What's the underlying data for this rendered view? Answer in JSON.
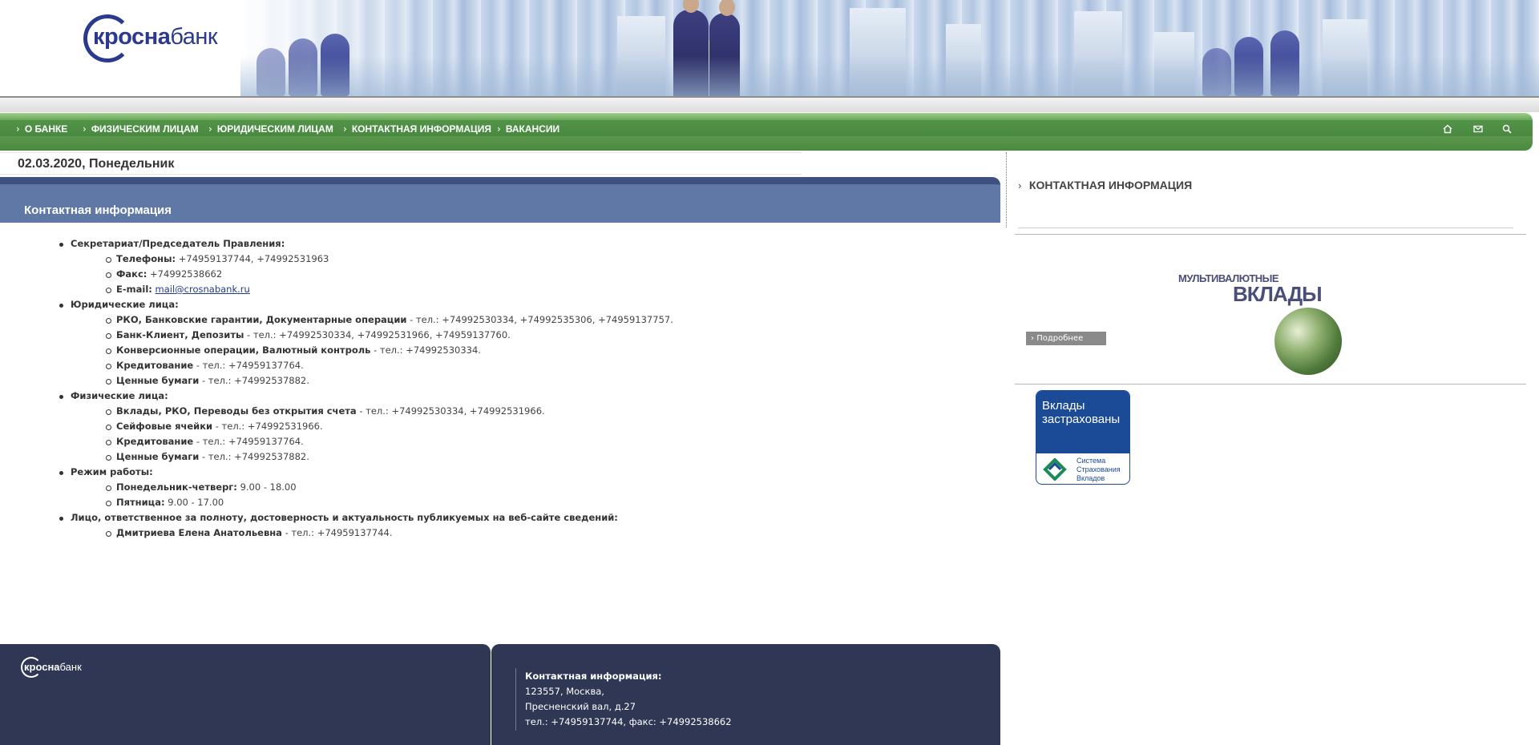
{
  "brand": {
    "name_bold": "кросна",
    "name_rest": "банк"
  },
  "nav": {
    "items": [
      {
        "label": "О БАНКЕ"
      },
      {
        "label": "ФИЗИЧЕСКИМ ЛИЦАМ"
      },
      {
        "label": "ЮРИДИЧЕСКИМ ЛИЦАМ"
      },
      {
        "label": "КОНТАКТНАЯ ИНФОРМАЦИЯ"
      },
      {
        "label": "ВАКАНСИИ"
      }
    ],
    "icons": [
      "home-icon",
      "mail-icon",
      "search-icon"
    ]
  },
  "date": "02.03.2020, Понедельник",
  "page_title": "Контактная информация",
  "content": {
    "secretariat": {
      "heading": "Секретариат/Председатель Правления:",
      "phones_label": "Телефоны:",
      "phones_value": " +74959137744, +74992531963",
      "fax_label": "Факс:",
      "fax_value": " +74992538662",
      "email_label": "E-mail:",
      "email_value": "mail@crosnabank.ru"
    },
    "legal": {
      "heading": "Юридические лица:",
      "items": [
        {
          "label": "РКО, Банковские гарантии, Документарные операции",
          "value": " - тел.: +74992530334, +74992535306, +74959137757."
        },
        {
          "label": "Банк-Клиент, Депозиты",
          "value": " - тел.: +74992530334, +74992531966, +74959137760."
        },
        {
          "label": "Конверсионные операции, Валютный контроль",
          "value": " - тел.: +74992530334."
        },
        {
          "label": "Кредитование",
          "value": " - тел.: +74959137764."
        },
        {
          "label": "Ценные бумаги",
          "value": " - тел.: +74992537882."
        }
      ]
    },
    "individuals": {
      "heading": "Физические лица:",
      "items": [
        {
          "label": "Вклады, РКО, Переводы без открытия счета",
          "value": " - тел.: +74992530334, +74992531966."
        },
        {
          "label": "Сейфовые ячейки",
          "value": " - тел.: +74992531966."
        },
        {
          "label": "Кредитование",
          "value": " - тел.: +74959137764."
        },
        {
          "label": "Ценные бумаги",
          "value": " - тел.: +74992537882."
        }
      ]
    },
    "hours": {
      "heading": "Режим работы:",
      "items": [
        {
          "label": "Понедельник-четверг:",
          "value": " 9.00 - 18.00"
        },
        {
          "label": "Пятница:",
          "value": " 9.00 - 17.00"
        }
      ]
    },
    "responsible": {
      "heading": "Лицо, ответственное за полноту, достоверность и актуальность публикуемых на веб-сайте сведений:",
      "items": [
        {
          "label": "Дмитриева  Елена  Анатольевна",
          "value": " - тел.: +74959137744."
        }
      ]
    }
  },
  "sidebar": {
    "section_title": "КОНТАКТНАЯ ИНФОРМАЦИЯ",
    "promo_small": "МУЛЬТИВАЛЮТНЫЕ",
    "promo_big": "ВКЛАДЫ",
    "more_label": "Подробнее",
    "insurance_title": "Вклады\nзастрахованы",
    "insurance_system": "Система\nСтрахования\nВкладов"
  },
  "footer": {
    "contact_heading": "Контактная информация:",
    "address_line1": "123557, Москва,",
    "address_line2": "Пресненский вал, д.27",
    "phones": "тел.: +74959137744, факс: +74992538662"
  },
  "colors": {
    "nav_green": "#5e9a50",
    "content_header": "#5f78a6",
    "footer": "#2f3755",
    "brand_blue": "#2b3a8f"
  }
}
